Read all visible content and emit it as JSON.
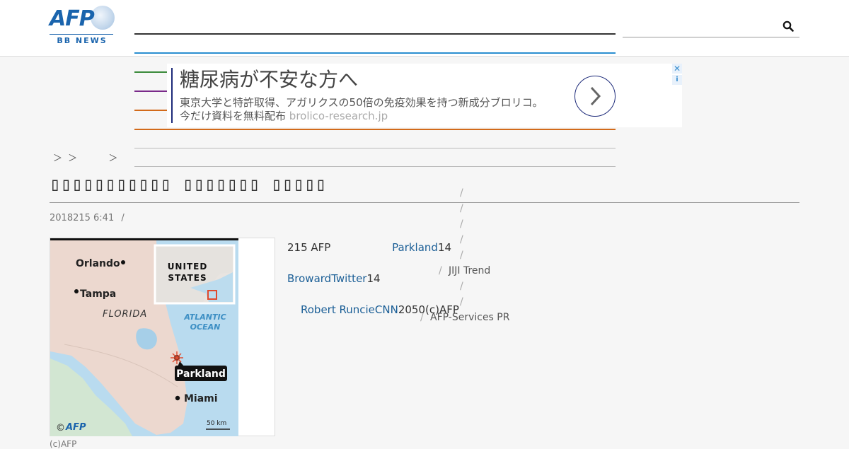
{
  "logo": {
    "brand": "AFP",
    "sub": "BB NEWS"
  },
  "search": {
    "placeholder": "",
    "icon": "search-icon"
  },
  "menu": {
    "line_colors": [
      "#333333",
      "#2a8fd0",
      "#3a8a3a",
      "#7a2a8a",
      "#d26a1a",
      "#d26a1a",
      "#bbbbbb",
      "#bbbbbb"
    ]
  },
  "ad": {
    "title": "糖尿病が不安な方へ",
    "desc": "東京大学と特許取得、アガリクスの50倍の免疫効果を持つ新成分ブロリコ。",
    "desc2": "今だけ資料を無料配布",
    "domain": "brolico-research.jp",
    "close": "✕",
    "info": "i"
  },
  "breadcrumb": [
    "＞",
    "＞",
    "＞"
  ],
  "article": {
    "title": "▯▯▯▯▯▯▯▯▯▯▯ ▯▯▯▯▯▯▯ ▯▯▯▯▯",
    "date": "2018215 6:41",
    "date_sep": "/",
    "p1": "215 AFP",
    "p1_link": "Parkland",
    "p1_tail": "14",
    "p2_link": "BrowardTwitter",
    "p2_tail": "14",
    "p3_link": "Robert RuncieCNN",
    "p3_tail": "2050(c)AFP",
    "caption": "(c)AFP"
  },
  "map": {
    "labels": [
      "Orlando",
      "Tampa",
      "FLORIDA",
      "UNITED",
      "STATES",
      "ATLANTIC",
      "OCEAN",
      "Parkland",
      "Miami",
      "50 km",
      "©",
      "AFP"
    ]
  },
  "sidebar": {
    "separators": [
      "/",
      "/",
      "/",
      "/",
      "/",
      "/",
      "/",
      "/",
      "/",
      "/",
      "/"
    ],
    "items": [
      "JIJI Trend",
      "AFP-Services PR"
    ]
  }
}
